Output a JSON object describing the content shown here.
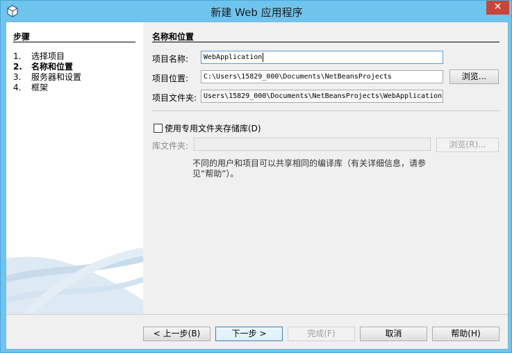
{
  "window": {
    "title": "新建 Web 应用程序",
    "close_label": "✕"
  },
  "steps": {
    "title": "步骤",
    "items": [
      {
        "num": "1.",
        "label": "选择项目"
      },
      {
        "num": "2.",
        "label": "名称和位置"
      },
      {
        "num": "3.",
        "label": "服务器和设置"
      },
      {
        "num": "4.",
        "label": "框架"
      }
    ],
    "current_index": 1
  },
  "panel": {
    "title": "名称和位置",
    "project_name_label": "项目名称:",
    "project_name_value": "WebApplication",
    "project_location_label": "项目位置:",
    "project_location_value": "C:\\Users\\15829_000\\Documents\\NetBeansProjects",
    "browse_label": "浏览...",
    "project_folder_label": "项目文件夹:",
    "project_folder_value": "Users\\15829_000\\Documents\\NetBeansProjects\\WebApplication",
    "dedicated_folder_checkbox": "使用专用文件夹存储库(D)",
    "dedicated_folder_checked": false,
    "library_folder_label": "库文件夹:",
    "library_folder_value": "",
    "library_browse_label": "浏览(R)...",
    "note_text": "不同的用户和项目可以共享相同的编译库（有关详细信息，请参见“帮助”）。"
  },
  "footer": {
    "back_label": "< 上一步(B)",
    "next_label": "下一步 >",
    "finish_label": "完成(F)",
    "cancel_label": "取消",
    "help_label": "帮助(H)"
  },
  "colors": {
    "titlebar": "#6fc4ee",
    "close_button": "#c7463b",
    "dialog_bg": "#f0f0f0",
    "default_button_border": "#3c7fb1"
  }
}
